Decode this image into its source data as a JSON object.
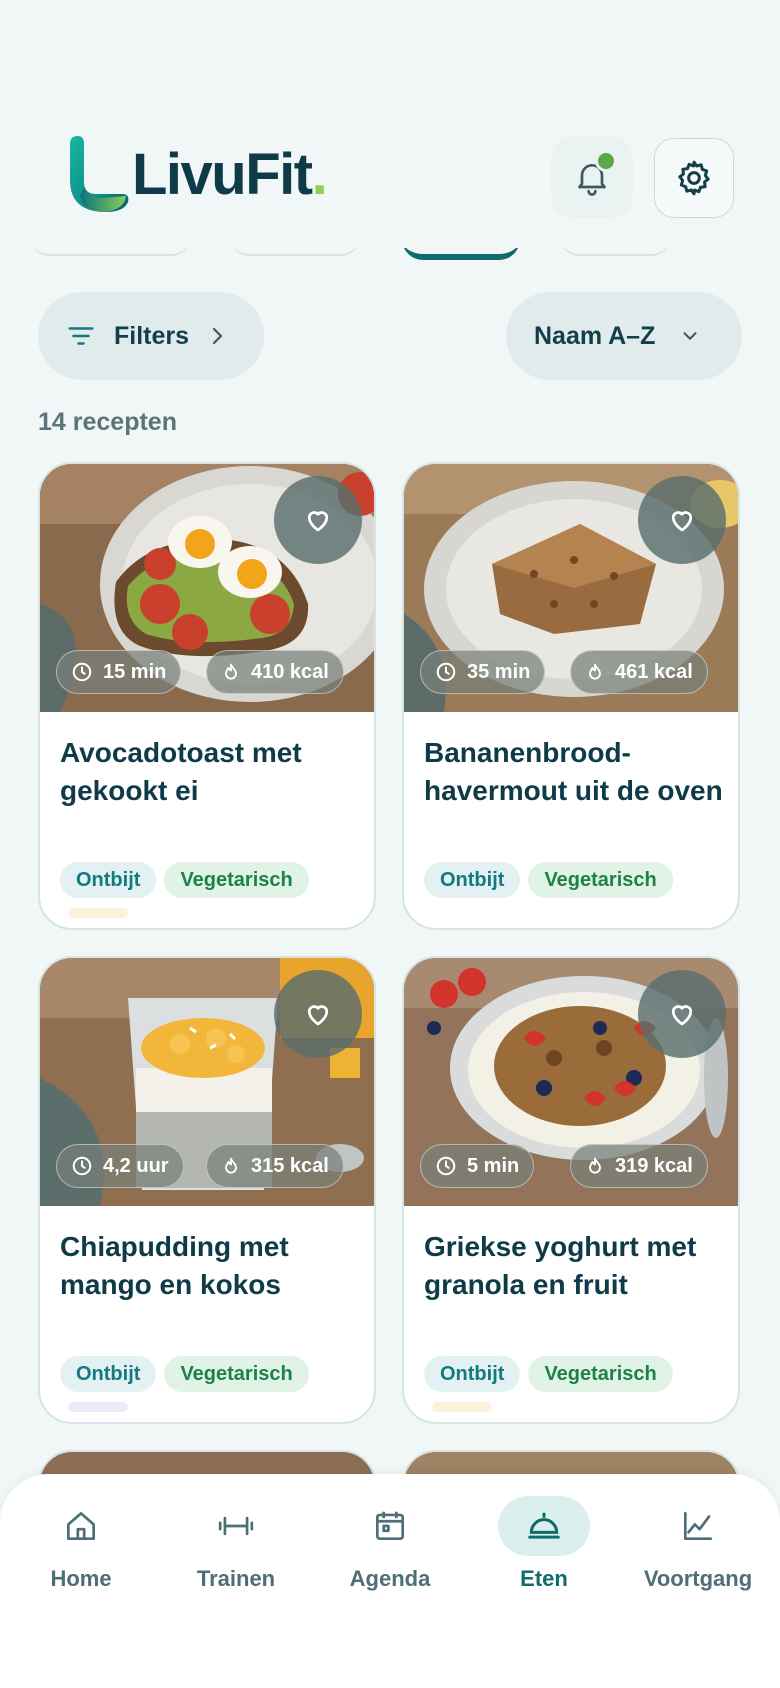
{
  "app": {
    "brand": "LivuFit",
    "brand_dot": "."
  },
  "header": {
    "bell_icon": "bell-icon",
    "settings_icon": "gear-icon",
    "notification_dot_color": "#5aa84a"
  },
  "toolbar": {
    "filters_label": "Filters",
    "sort_label": "Naam A–Z"
  },
  "results": {
    "count_label": "14 recepten"
  },
  "recipes": [
    {
      "title": "Avocadotoast met gekookt ei",
      "time": "15 min",
      "kcal": "410 kcal",
      "tags": [
        "Ontbijt",
        "Vegetarisch"
      ]
    },
    {
      "title": "Bananenbrood-havermout uit de oven",
      "time": "35 min",
      "kcal": "461 kcal",
      "tags": [
        "Ontbijt",
        "Vegetarisch"
      ]
    },
    {
      "title": "Chiapudding met mango en kokos",
      "time": "4,2 uur",
      "kcal": "315 kcal",
      "tags": [
        "Ontbijt",
        "Vegetarisch"
      ]
    },
    {
      "title": "Griekse yoghurt met granola en fruit",
      "time": "5 min",
      "kcal": "319 kcal",
      "tags": [
        "Ontbijt",
        "Vegetarisch"
      ]
    }
  ],
  "nav": {
    "items": [
      {
        "label": "Home",
        "icon": "home-icon"
      },
      {
        "label": "Trainen",
        "icon": "dumbbell-icon"
      },
      {
        "label": "Agenda",
        "icon": "calendar-icon"
      },
      {
        "label": "Eten",
        "icon": "cloche-icon"
      },
      {
        "label": "Voortgang",
        "icon": "chart-icon"
      }
    ],
    "active": "Eten"
  },
  "colors": {
    "accent": "#0f6b6e",
    "brand_green": "#8fd14f",
    "text_dark": "#0f3b49"
  }
}
